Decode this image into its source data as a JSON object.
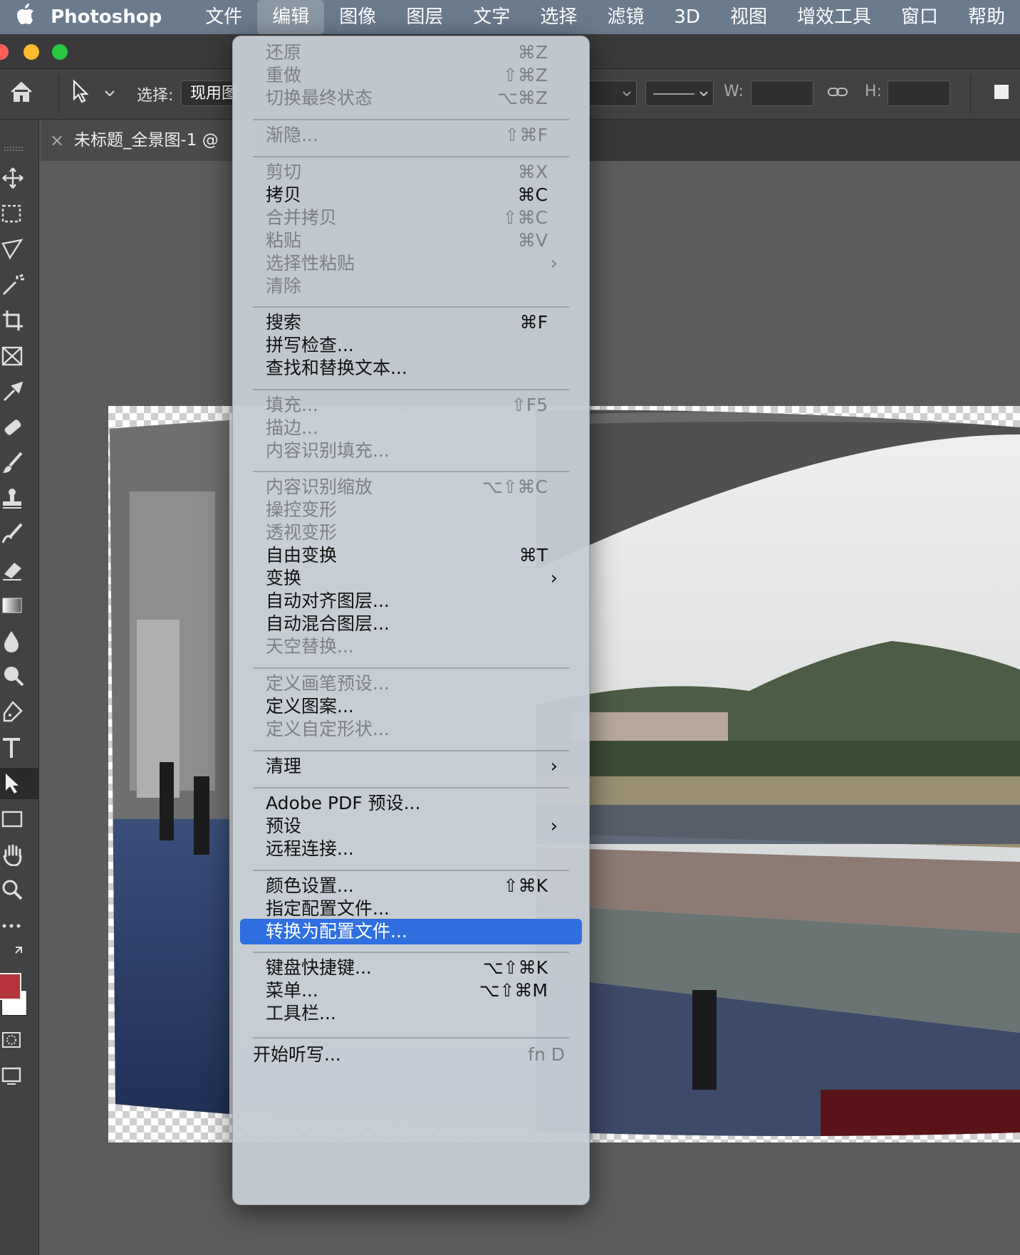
{
  "menubar": {
    "apple": "",
    "app": "Photoshop",
    "items": [
      "文件",
      "编辑",
      "图像",
      "图层",
      "文字",
      "选择",
      "滤镜",
      "3D",
      "视图",
      "增效工具",
      "窗口",
      "帮助"
    ]
  },
  "options": {
    "select_label": "选择:",
    "select_value": "现用图",
    "w_label": "W:",
    "h_label": "H:"
  },
  "tab": {
    "title": "未标题_全景图-1 @",
    "close": "×"
  },
  "colors": {
    "foreground": "#b5343a",
    "background": "#ffffff",
    "highlight": "#2f6fe0"
  },
  "menu": {
    "items": [
      {
        "label": "还原",
        "shortcut": "⌘Z",
        "disabled": true
      },
      {
        "label": "重做",
        "shortcut": "⇧⌘Z",
        "disabled": true
      },
      {
        "label": "切换最终状态",
        "shortcut": "⌥⌘Z",
        "disabled": true
      },
      {
        "label": "渐隐...",
        "shortcut": "⇧⌘F",
        "disabled": true
      },
      {
        "label": "剪切",
        "shortcut": "⌘X",
        "disabled": true
      },
      {
        "label": "拷贝",
        "shortcut": "⌘C",
        "disabled": false
      },
      {
        "label": "合并拷贝",
        "shortcut": "⇧⌘C",
        "disabled": true
      },
      {
        "label": "粘贴",
        "shortcut": "⌘V",
        "disabled": true
      },
      {
        "label": "选择性粘贴",
        "submenu": true,
        "disabled": true
      },
      {
        "label": "清除",
        "disabled": true
      },
      {
        "label": "搜索",
        "shortcut": "⌘F",
        "disabled": false
      },
      {
        "label": "拼写检查...",
        "disabled": false
      },
      {
        "label": "查找和替换文本...",
        "disabled": false
      },
      {
        "label": "填充...",
        "shortcut": "⇧F5",
        "disabled": true
      },
      {
        "label": "描边...",
        "disabled": true
      },
      {
        "label": "内容识别填充...",
        "disabled": true
      },
      {
        "label": "内容识别缩放",
        "shortcut": "⌥⇧⌘C",
        "disabled": true
      },
      {
        "label": "操控变形",
        "disabled": true
      },
      {
        "label": "透视变形",
        "disabled": true
      },
      {
        "label": "自由变换",
        "shortcut": "⌘T",
        "disabled": false
      },
      {
        "label": "变换",
        "submenu": true,
        "disabled": false
      },
      {
        "label": "自动对齐图层...",
        "disabled": false
      },
      {
        "label": "自动混合图层...",
        "disabled": false
      },
      {
        "label": "天空替换...",
        "disabled": true
      },
      {
        "label": "定义画笔预设...",
        "disabled": true
      },
      {
        "label": "定义图案...",
        "disabled": false
      },
      {
        "label": "定义自定形状...",
        "disabled": true
      },
      {
        "label": "清理",
        "submenu": true,
        "disabled": false
      },
      {
        "label": "Adobe PDF 预设...",
        "disabled": false
      },
      {
        "label": "预设",
        "submenu": true,
        "disabled": false
      },
      {
        "label": "远程连接...",
        "disabled": false
      },
      {
        "label": "颜色设置...",
        "shortcut": "⇧⌘K",
        "disabled": false
      },
      {
        "label": "指定配置文件...",
        "disabled": false
      },
      {
        "label": "转换为配置文件...",
        "disabled": false,
        "highlighted": true
      },
      {
        "label": "键盘快捷键...",
        "shortcut": "⌥⇧⌘K",
        "disabled": false
      },
      {
        "label": "菜单...",
        "shortcut": "⌥⇧⌘M",
        "disabled": false
      },
      {
        "label": "工具栏...",
        "disabled": false
      },
      {
        "label": "开始听写...",
        "shortcut": "fn D",
        "disabled": false
      }
    ]
  }
}
